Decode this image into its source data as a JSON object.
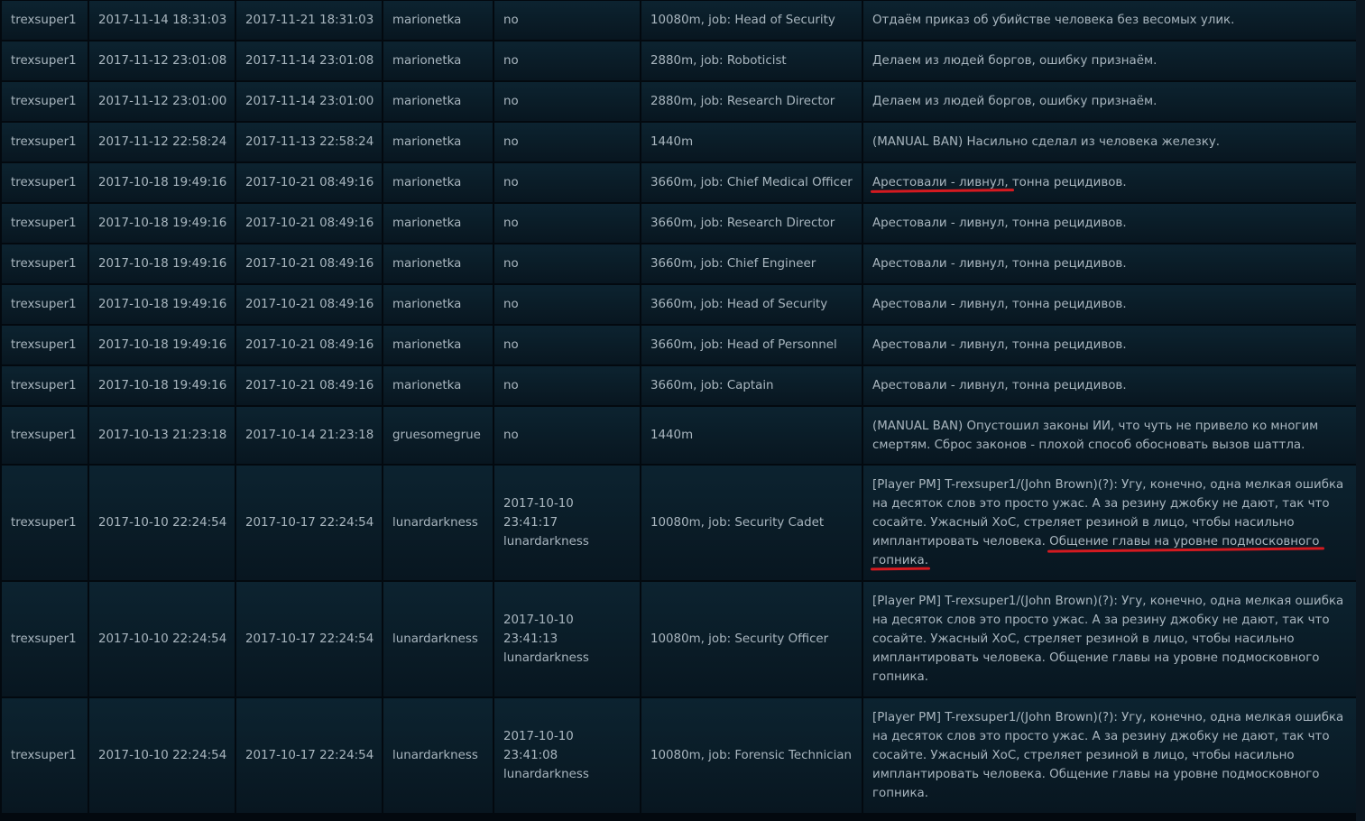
{
  "rows": [
    {
      "ckey": "trexsuper1",
      "bantime": "2017-11-14 18:31:03",
      "expiry": "2017-11-21 18:31:03",
      "admin": "marionetka",
      "unbanned": "no",
      "unban_by": "",
      "duration": "10080m, job: Head of Security",
      "reason": "Отдаём приказ об убийстве человека без весомых улик.",
      "h": "h43"
    },
    {
      "ckey": "trexsuper1",
      "bantime": "2017-11-12 23:01:08",
      "expiry": "2017-11-14 23:01:08",
      "admin": "marionetka",
      "unbanned": "no",
      "unban_by": "",
      "duration": "2880m, job: Roboticist",
      "reason": "Делаем из людей боргов, ошибку признаём.",
      "h": "h43"
    },
    {
      "ckey": "trexsuper1",
      "bantime": "2017-11-12 23:01:00",
      "expiry": "2017-11-14 23:01:00",
      "admin": "marionetka",
      "unbanned": "no",
      "unban_by": "",
      "duration": "2880m, job: Research Director",
      "reason": "Делаем из людей боргов, ошибку признаём.",
      "h": "h43"
    },
    {
      "ckey": "trexsuper1",
      "bantime": "2017-11-12 22:58:24",
      "expiry": "2017-11-13 22:58:24",
      "admin": "marionetka",
      "unbanned": "no",
      "unban_by": "",
      "duration": "1440m",
      "reason": "(MANUAL BAN) Насильно сделал из человека железку.",
      "h": "h43"
    },
    {
      "ckey": "trexsuper1",
      "bantime": "2017-10-18 19:49:16",
      "expiry": "2017-10-21 08:49:16",
      "admin": "marionetka",
      "unbanned": "no",
      "unban_by": "",
      "duration": "3660m, job: Chief Medical Officer",
      "reason_marked": "Арестовали - ливнул,",
      "reason_rest": " тонна рецидивов.",
      "h": "h43"
    },
    {
      "ckey": "trexsuper1",
      "bantime": "2017-10-18 19:49:16",
      "expiry": "2017-10-21 08:49:16",
      "admin": "marionetka",
      "unbanned": "no",
      "unban_by": "",
      "duration": "3660m, job: Research Director",
      "reason": "Арестовали - ливнул, тонна рецидивов.",
      "h": "h43"
    },
    {
      "ckey": "trexsuper1",
      "bantime": "2017-10-18 19:49:16",
      "expiry": "2017-10-21 08:49:16",
      "admin": "marionetka",
      "unbanned": "no",
      "unban_by": "",
      "duration": "3660m, job: Chief Engineer",
      "reason": "Арестовали - ливнул, тонна рецидивов.",
      "h": "h43"
    },
    {
      "ckey": "trexsuper1",
      "bantime": "2017-10-18 19:49:16",
      "expiry": "2017-10-21 08:49:16",
      "admin": "marionetka",
      "unbanned": "no",
      "unban_by": "",
      "duration": "3660m, job: Head of Security",
      "reason": "Арестовали - ливнул, тонна рецидивов.",
      "h": "h43"
    },
    {
      "ckey": "trexsuper1",
      "bantime": "2017-10-18 19:49:16",
      "expiry": "2017-10-21 08:49:16",
      "admin": "marionetka",
      "unbanned": "no",
      "unban_by": "",
      "duration": "3660m, job: Head of Personnel",
      "reason": "Арестовали - ливнул, тонна рецидивов.",
      "h": "h43"
    },
    {
      "ckey": "trexsuper1",
      "bantime": "2017-10-18 19:49:16",
      "expiry": "2017-10-21 08:49:16",
      "admin": "marionetka",
      "unbanned": "no",
      "unban_by": "",
      "duration": "3660m, job: Captain",
      "reason": "Арестовали - ливнул, тонна рецидивов.",
      "h": "h43"
    },
    {
      "ckey": "trexsuper1",
      "bantime": "2017-10-13 21:23:18",
      "expiry": "2017-10-14 21:23:18",
      "admin": "gruesomegrue",
      "unbanned": "no",
      "unban_by": "",
      "duration": "1440m",
      "reason": "(MANUAL BAN) Опустошил законы ИИ, что чуть не привело ко многим смертям. Сброс законов - плохой способ обосновать вызов шаттла.",
      "h": "h63"
    },
    {
      "ckey": "trexsuper1",
      "bantime": "2017-10-10 22:24:54",
      "expiry": "2017-10-17 22:24:54",
      "admin": "lunardarkness",
      "unbanned": "2017-10-10 23:41:17",
      "unban_by": "lunardarkness",
      "duration": "10080m, job: Security Cadet",
      "reason_lines": [
        "[Player PM] T-rexsuper1/(John Brown)(?): Угу, конечно, одна мелкая ошибка",
        "на десяток слов это просто ужас. А за резину джобку не дают, так что",
        "сосайте. Ужасный ХоС, стреляет резиной в лицо, чтобы насильно"
      ],
      "reason_l4a": "имплантировать человека. ",
      "reason_l4b": "Общение главы на уровне подмосковного",
      "reason_l5": "гопника",
      "reason_l5rest": ".",
      "h": "h127"
    },
    {
      "ckey": "trexsuper1",
      "bantime": "2017-10-10 22:24:54",
      "expiry": "2017-10-17 22:24:54",
      "admin": "lunardarkness",
      "unbanned": "2017-10-10 23:41:13",
      "unban_by": "lunardarkness",
      "duration": "10080m, job: Security Officer",
      "reason_lines": [
        "[Player PM] T-rexsuper1/(John Brown)(?): Угу, конечно, одна мелкая ошибка",
        "на десяток слов это просто ужас. А за резину джобку не дают, так что",
        "сосайте. Ужасный ХоС, стреляет резиной в лицо, чтобы насильно",
        "имплантировать человека. Общение главы на уровне подмосковного",
        "гопника."
      ],
      "h": "h127"
    },
    {
      "ckey": "trexsuper1",
      "bantime": "2017-10-10 22:24:54",
      "expiry": "2017-10-17 22:24:54",
      "admin": "lunardarkness",
      "unbanned": "2017-10-10 23:41:08",
      "unban_by": "lunardarkness",
      "duration": "10080m, job: Forensic Technician",
      "reason_lines": [
        "[Player PM] T-rexsuper1/(John Brown)(?): Угу, конечно, одна мелкая ошибка",
        "на десяток слов это просто ужас. А за резину джобку не дают, так что",
        "сосайте. Ужасный ХоС, стреляет резиной в лицо, чтобы насильно",
        "имплантировать человека. Общение главы на уровне подмосковного",
        "гопника."
      ],
      "h": "h127"
    }
  ]
}
